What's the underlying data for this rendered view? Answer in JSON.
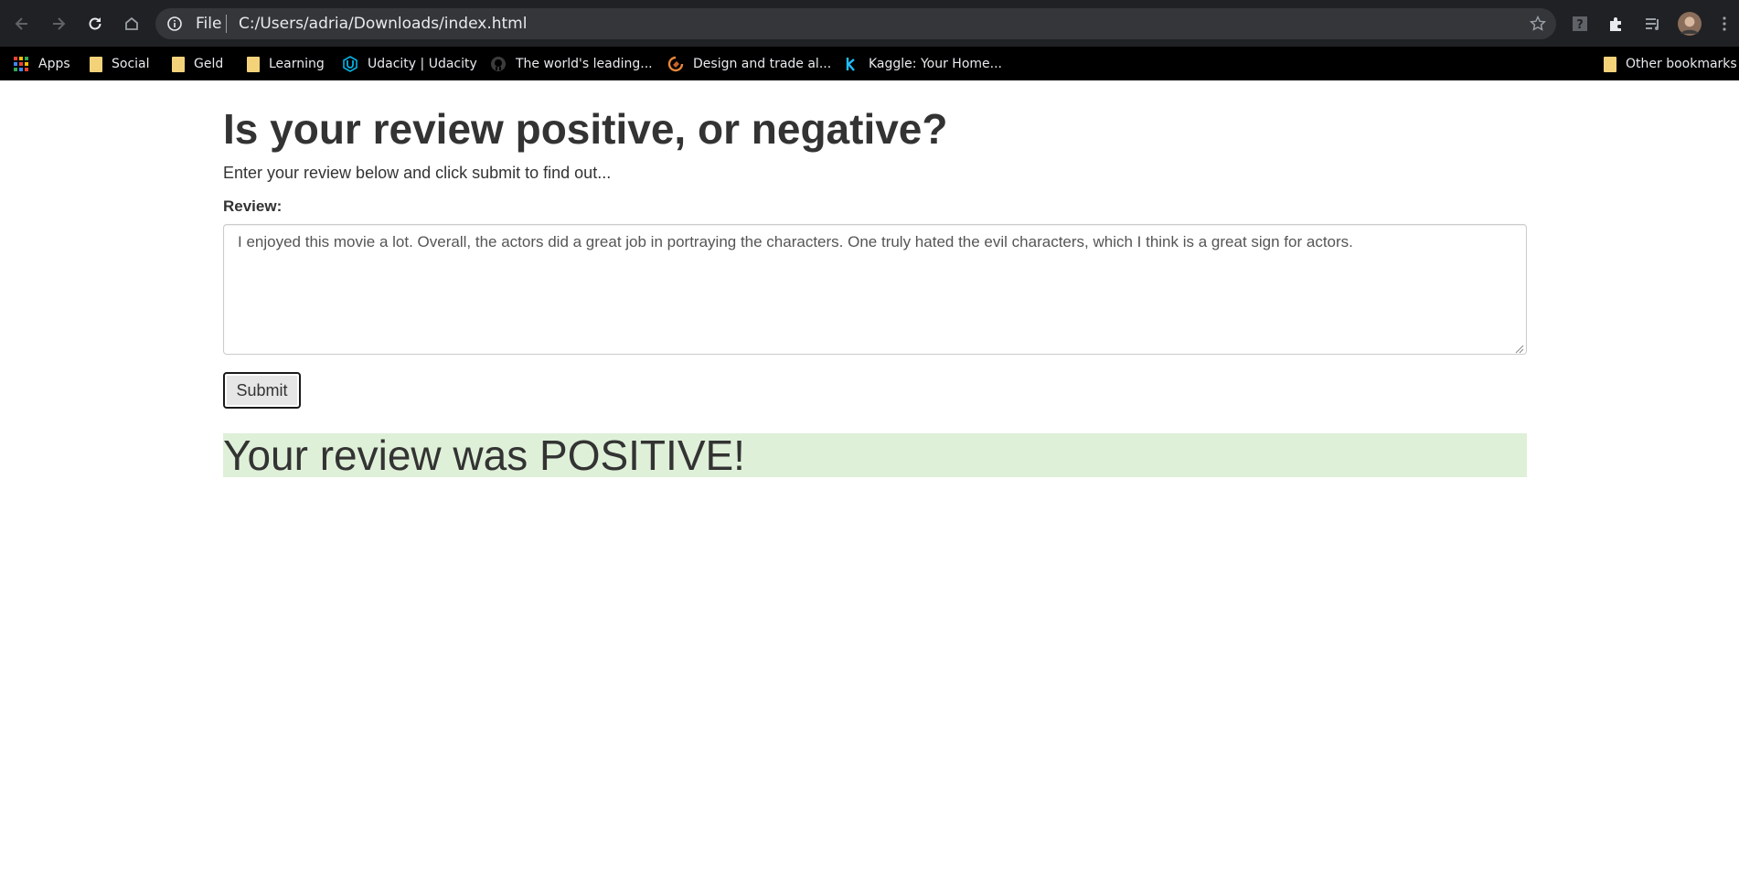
{
  "browser": {
    "omnibox": {
      "scheme_chip": "File",
      "url": "C:/Users/adria/Downloads/index.html"
    },
    "bookmarks": [
      {
        "label": "Apps",
        "icon": "apps-grid-icon"
      },
      {
        "label": "Social",
        "icon": "folder-icon"
      },
      {
        "label": "Geld",
        "icon": "folder-icon"
      },
      {
        "label": "Learning",
        "icon": "folder-icon"
      },
      {
        "label": "Udacity | Udacity",
        "icon": "udacity-icon"
      },
      {
        "label": "The world's leading...",
        "icon": "github-icon"
      },
      {
        "label": "Design and trade al...",
        "icon": "design-logo-icon"
      },
      {
        "label": "Kaggle: Your Home...",
        "icon": "kaggle-icon"
      },
      {
        "label": "Other bookmarks",
        "icon": "folder-icon"
      }
    ],
    "colors": {
      "toolbar": "#202124",
      "omnibox": "#35363a",
      "bookmarks_bar": "#000000",
      "folder": "#f3d27a"
    }
  },
  "page": {
    "heading": "Is your review positive, or negative?",
    "intro": "Enter your review below and click submit to find out...",
    "review_label": "Review:",
    "review_text": "I enjoyed this movie a lot. Overall, the actors did a great job in portraying the characters. One truly hated the evil characters, which I think is a great sign for actors.",
    "submit_label": "Submit",
    "result": "Your review was POSITIVE!",
    "colors": {
      "result_background": "#dff0d8",
      "text": "#333333"
    }
  }
}
